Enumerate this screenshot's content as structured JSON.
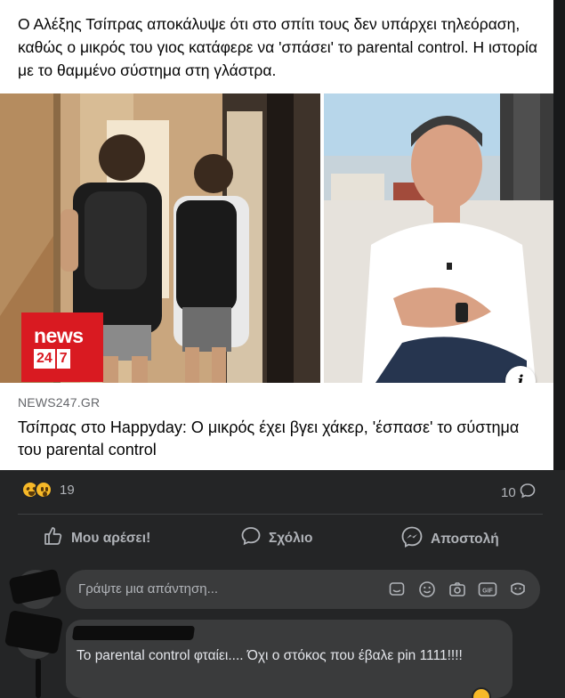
{
  "post": {
    "text": "Ο Αλέξης Τσίπρας αποκάλυψε ότι στο σπίτι τους δεν υπάρχει τηλεόραση, καθώς ο μικρός του γιος κατάφερε να 'σπάσει' το parental control. Η ιστορία με το θαμμένο σύστημα στη γλάστρα."
  },
  "link_preview": {
    "logo_word": "news",
    "logo_digits": [
      "24",
      "7"
    ],
    "info_icon": "info-icon",
    "domain": "NEWS247.GR",
    "title": "Τσίπρας στο Happyday: Ο μικρός έχει βγει χάκερ, 'έσπασε' το σύστημα του parental control"
  },
  "stats": {
    "reaction_icons": [
      "laughing-emoji-icon",
      "wow-emoji-icon"
    ],
    "reactions_count": "19",
    "comments_count": "10"
  },
  "actions": {
    "like_label": "Μου αρέσει!",
    "comment_label": "Σχόλιο",
    "send_label": "Αποστολή"
  },
  "reply": {
    "placeholder": "Γράψτε μια απάντηση...",
    "icons": [
      "sticker-icon",
      "emoji-icon",
      "camera-icon",
      "gif-icon",
      "avatar-sticker-icon"
    ]
  },
  "comment": {
    "text": "Το parental control φταίει.... Όχι ο στόκος που έβαλε pin 1111!!!!"
  },
  "colors": {
    "background": "#242526",
    "card": "#ffffff",
    "news_red": "#d91a21",
    "muted_text": "#b0b3b8",
    "bubble": "#3a3b3c"
  }
}
